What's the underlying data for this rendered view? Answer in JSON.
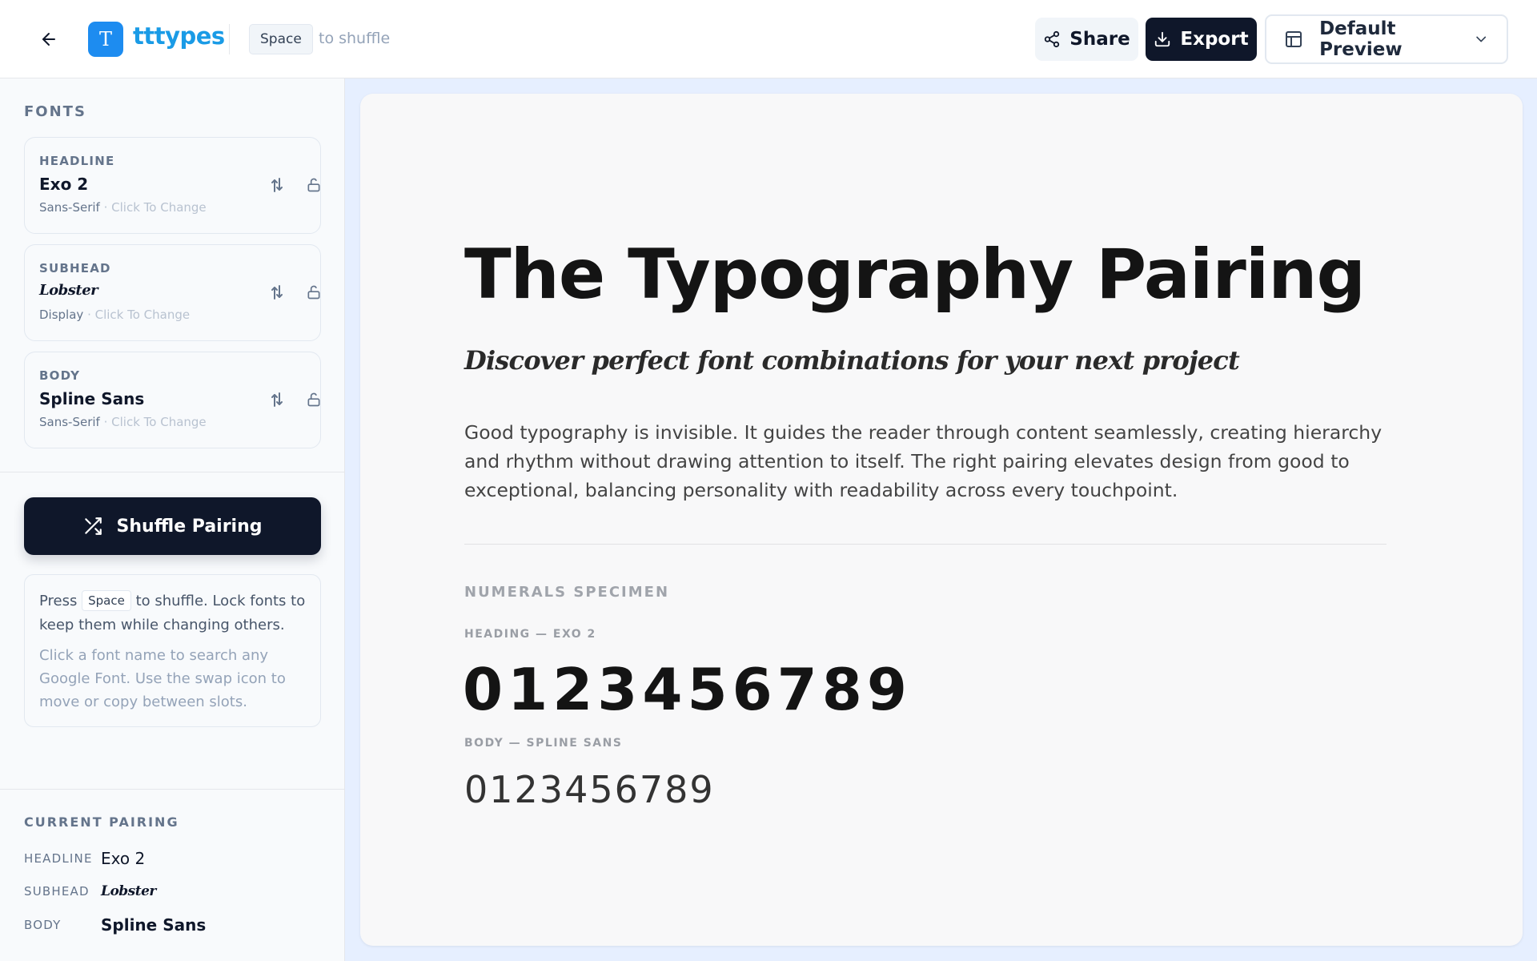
{
  "header": {
    "back_icon": "arrow-left-icon",
    "logo_letter": "T",
    "logo_text": "tttypes",
    "shortcut_key": "Space",
    "shortcut_hint": "to shuffle",
    "share_label": "Share",
    "export_label": "Export",
    "preview_select_value": "Default Preview",
    "colors": {
      "brand": "#1d8cf0",
      "brand_text": "#1a9be6",
      "dark": "#0f172a"
    }
  },
  "sidebar": {
    "fonts_label": "FONTS",
    "fonts": [
      {
        "role": "HEADLINE",
        "name": "Exo 2",
        "category": "Sans-Serif",
        "hint": "· Click To Change"
      },
      {
        "role": "SUBHEAD",
        "name": "Lobster",
        "category": "Display",
        "hint": "· Click To Change"
      },
      {
        "role": "BODY",
        "name": "Spline Sans",
        "category": "Sans-Serif",
        "hint": "· Click To Change"
      }
    ],
    "shuffle_button": "Shuffle Pairing",
    "help": {
      "press": "Press",
      "key": "Space",
      "rest": "to shuffle. Lock fonts to keep them while changing others.",
      "muted": "Click a font name to search any Google Font. Use the swap icon to move or copy between slots."
    },
    "current_pairing_label": "CURRENT PAIRING",
    "current_pairing": [
      {
        "key": "HEADLINE",
        "value": "Exo 2"
      },
      {
        "key": "SUBHEAD",
        "value": "Lobster"
      },
      {
        "key": "BODY",
        "value": "Spline Sans"
      }
    ]
  },
  "preview": {
    "title": "The Typography Pairing",
    "subtitle": "Discover perfect font combinations for your next project",
    "body": "Good typography is invisible. It guides the reader through content seamlessly, creating hierarchy and rhythm without drawing attention to itself. The right pairing elevates design from good to exceptional, balancing personality with readability across every touchpoint.",
    "numerals_label": "NUMERALS SPECIMEN",
    "heading_numerals_label": "HEADING — EXO 2",
    "heading_numerals": "0123456789",
    "body_numerals_label": "BODY — SPLINE SANS",
    "body_numerals": "0123456789"
  }
}
